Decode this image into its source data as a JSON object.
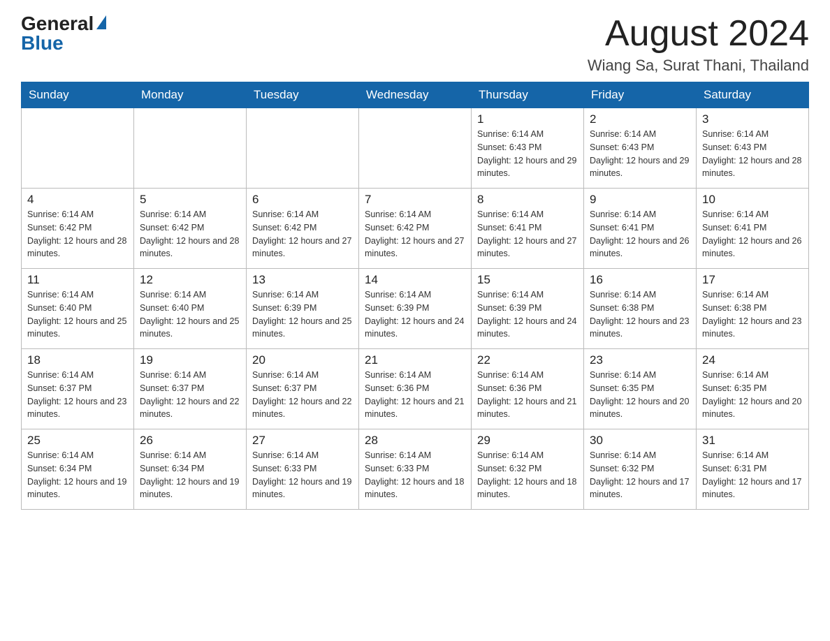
{
  "header": {
    "logo_general": "General",
    "logo_blue": "Blue",
    "month_title": "August 2024",
    "location": "Wiang Sa, Surat Thani, Thailand"
  },
  "days_of_week": [
    "Sunday",
    "Monday",
    "Tuesday",
    "Wednesday",
    "Thursday",
    "Friday",
    "Saturday"
  ],
  "weeks": [
    [
      {
        "day": "",
        "sunrise": "",
        "sunset": "",
        "daylight": ""
      },
      {
        "day": "",
        "sunrise": "",
        "sunset": "",
        "daylight": ""
      },
      {
        "day": "",
        "sunrise": "",
        "sunset": "",
        "daylight": ""
      },
      {
        "day": "",
        "sunrise": "",
        "sunset": "",
        "daylight": ""
      },
      {
        "day": "1",
        "sunrise": "Sunrise: 6:14 AM",
        "sunset": "Sunset: 6:43 PM",
        "daylight": "Daylight: 12 hours and 29 minutes."
      },
      {
        "day": "2",
        "sunrise": "Sunrise: 6:14 AM",
        "sunset": "Sunset: 6:43 PM",
        "daylight": "Daylight: 12 hours and 29 minutes."
      },
      {
        "day": "3",
        "sunrise": "Sunrise: 6:14 AM",
        "sunset": "Sunset: 6:43 PM",
        "daylight": "Daylight: 12 hours and 28 minutes."
      }
    ],
    [
      {
        "day": "4",
        "sunrise": "Sunrise: 6:14 AM",
        "sunset": "Sunset: 6:42 PM",
        "daylight": "Daylight: 12 hours and 28 minutes."
      },
      {
        "day": "5",
        "sunrise": "Sunrise: 6:14 AM",
        "sunset": "Sunset: 6:42 PM",
        "daylight": "Daylight: 12 hours and 28 minutes."
      },
      {
        "day": "6",
        "sunrise": "Sunrise: 6:14 AM",
        "sunset": "Sunset: 6:42 PM",
        "daylight": "Daylight: 12 hours and 27 minutes."
      },
      {
        "day": "7",
        "sunrise": "Sunrise: 6:14 AM",
        "sunset": "Sunset: 6:42 PM",
        "daylight": "Daylight: 12 hours and 27 minutes."
      },
      {
        "day": "8",
        "sunrise": "Sunrise: 6:14 AM",
        "sunset": "Sunset: 6:41 PM",
        "daylight": "Daylight: 12 hours and 27 minutes."
      },
      {
        "day": "9",
        "sunrise": "Sunrise: 6:14 AM",
        "sunset": "Sunset: 6:41 PM",
        "daylight": "Daylight: 12 hours and 26 minutes."
      },
      {
        "day": "10",
        "sunrise": "Sunrise: 6:14 AM",
        "sunset": "Sunset: 6:41 PM",
        "daylight": "Daylight: 12 hours and 26 minutes."
      }
    ],
    [
      {
        "day": "11",
        "sunrise": "Sunrise: 6:14 AM",
        "sunset": "Sunset: 6:40 PM",
        "daylight": "Daylight: 12 hours and 25 minutes."
      },
      {
        "day": "12",
        "sunrise": "Sunrise: 6:14 AM",
        "sunset": "Sunset: 6:40 PM",
        "daylight": "Daylight: 12 hours and 25 minutes."
      },
      {
        "day": "13",
        "sunrise": "Sunrise: 6:14 AM",
        "sunset": "Sunset: 6:39 PM",
        "daylight": "Daylight: 12 hours and 25 minutes."
      },
      {
        "day": "14",
        "sunrise": "Sunrise: 6:14 AM",
        "sunset": "Sunset: 6:39 PM",
        "daylight": "Daylight: 12 hours and 24 minutes."
      },
      {
        "day": "15",
        "sunrise": "Sunrise: 6:14 AM",
        "sunset": "Sunset: 6:39 PM",
        "daylight": "Daylight: 12 hours and 24 minutes."
      },
      {
        "day": "16",
        "sunrise": "Sunrise: 6:14 AM",
        "sunset": "Sunset: 6:38 PM",
        "daylight": "Daylight: 12 hours and 23 minutes."
      },
      {
        "day": "17",
        "sunrise": "Sunrise: 6:14 AM",
        "sunset": "Sunset: 6:38 PM",
        "daylight": "Daylight: 12 hours and 23 minutes."
      }
    ],
    [
      {
        "day": "18",
        "sunrise": "Sunrise: 6:14 AM",
        "sunset": "Sunset: 6:37 PM",
        "daylight": "Daylight: 12 hours and 23 minutes."
      },
      {
        "day": "19",
        "sunrise": "Sunrise: 6:14 AM",
        "sunset": "Sunset: 6:37 PM",
        "daylight": "Daylight: 12 hours and 22 minutes."
      },
      {
        "day": "20",
        "sunrise": "Sunrise: 6:14 AM",
        "sunset": "Sunset: 6:37 PM",
        "daylight": "Daylight: 12 hours and 22 minutes."
      },
      {
        "day": "21",
        "sunrise": "Sunrise: 6:14 AM",
        "sunset": "Sunset: 6:36 PM",
        "daylight": "Daylight: 12 hours and 21 minutes."
      },
      {
        "day": "22",
        "sunrise": "Sunrise: 6:14 AM",
        "sunset": "Sunset: 6:36 PM",
        "daylight": "Daylight: 12 hours and 21 minutes."
      },
      {
        "day": "23",
        "sunrise": "Sunrise: 6:14 AM",
        "sunset": "Sunset: 6:35 PM",
        "daylight": "Daylight: 12 hours and 20 minutes."
      },
      {
        "day": "24",
        "sunrise": "Sunrise: 6:14 AM",
        "sunset": "Sunset: 6:35 PM",
        "daylight": "Daylight: 12 hours and 20 minutes."
      }
    ],
    [
      {
        "day": "25",
        "sunrise": "Sunrise: 6:14 AM",
        "sunset": "Sunset: 6:34 PM",
        "daylight": "Daylight: 12 hours and 19 minutes."
      },
      {
        "day": "26",
        "sunrise": "Sunrise: 6:14 AM",
        "sunset": "Sunset: 6:34 PM",
        "daylight": "Daylight: 12 hours and 19 minutes."
      },
      {
        "day": "27",
        "sunrise": "Sunrise: 6:14 AM",
        "sunset": "Sunset: 6:33 PM",
        "daylight": "Daylight: 12 hours and 19 minutes."
      },
      {
        "day": "28",
        "sunrise": "Sunrise: 6:14 AM",
        "sunset": "Sunset: 6:33 PM",
        "daylight": "Daylight: 12 hours and 18 minutes."
      },
      {
        "day": "29",
        "sunrise": "Sunrise: 6:14 AM",
        "sunset": "Sunset: 6:32 PM",
        "daylight": "Daylight: 12 hours and 18 minutes."
      },
      {
        "day": "30",
        "sunrise": "Sunrise: 6:14 AM",
        "sunset": "Sunset: 6:32 PM",
        "daylight": "Daylight: 12 hours and 17 minutes."
      },
      {
        "day": "31",
        "sunrise": "Sunrise: 6:14 AM",
        "sunset": "Sunset: 6:31 PM",
        "daylight": "Daylight: 12 hours and 17 minutes."
      }
    ]
  ]
}
